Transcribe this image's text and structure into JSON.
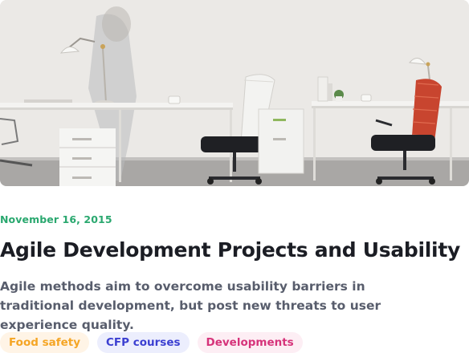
{
  "post": {
    "date": "November 16, 2015",
    "title": "Agile Development Projects and Usability",
    "description": "Agile methods aim to overcome usability barriers in traditional development, but post new threats to user experience quality.",
    "hero_image": "office-workspace-photo"
  },
  "tags": [
    {
      "label": "Food safety",
      "text_color": "#f5a524",
      "bg_color": "#fff4e6"
    },
    {
      "label": "CFP courses",
      "text_color": "#3b3fd1",
      "bg_color": "#eceefd"
    },
    {
      "label": "Developments",
      "text_color": "#d6337a",
      "bg_color": "#fdeef4"
    }
  ],
  "colors": {
    "date": "#2aa86f",
    "title": "#1b1d24",
    "description": "#4a5060"
  }
}
